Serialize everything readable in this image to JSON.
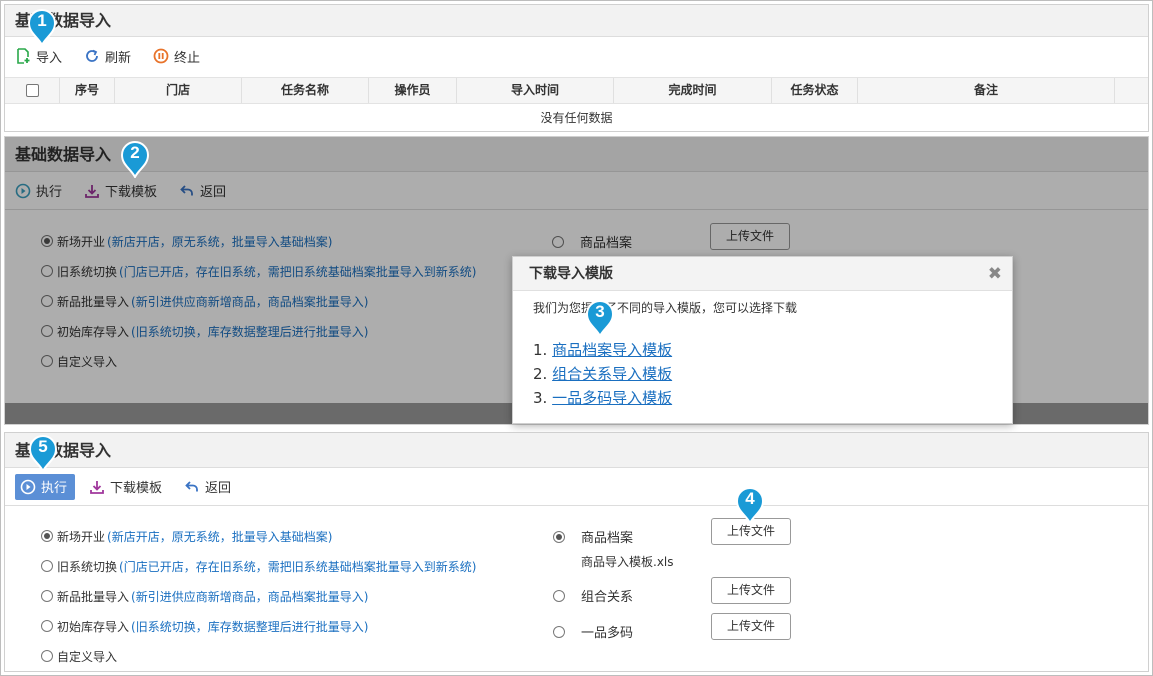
{
  "panel1": {
    "title": "基础数据导入",
    "toolbar": {
      "import": "导入",
      "refresh": "刷新",
      "stop": "终止"
    },
    "columns": [
      "序号",
      "门店",
      "任务名称",
      "操作员",
      "导入时间",
      "完成时间",
      "任务状态",
      "备注"
    ],
    "empty_text": "没有任何数据"
  },
  "panel2": {
    "title": "基础数据导入",
    "toolbar": {
      "execute": "执行",
      "download": "下载模板",
      "back": "返回"
    },
    "options": [
      {
        "label": "新场开业",
        "hint": "(新店开店，原无系统，批量导入基础档案)"
      },
      {
        "label": "旧系统切换",
        "hint": "(门店已开店，存在旧系统，需把旧系统基础档案批量导入到新系统)"
      },
      {
        "label": "新品批量导入",
        "hint": "(新引进供应商新增商品，商品档案批量导入)"
      },
      {
        "label": "初始库存导入",
        "hint": "(旧系统切换，库存数据整理后进行批量导入)"
      },
      {
        "label": "自定义导入",
        "hint": ""
      }
    ],
    "right_label": "商品档案",
    "upload": "上传文件"
  },
  "dialog": {
    "title": "下载导入模版",
    "description": "我们为您提供了不同的导入模版，您可以选择下载",
    "items": [
      {
        "num": "1.",
        "label": "商品档案导入模板"
      },
      {
        "num": "2.",
        "label": "组合关系导入模板"
      },
      {
        "num": "3.",
        "label": "一品多码导入模板"
      }
    ]
  },
  "panel3": {
    "title": "基础数据导入",
    "toolbar": {
      "execute": "执行",
      "download": "下载模板",
      "back": "返回"
    },
    "options": [
      {
        "label": "新场开业",
        "hint": "(新店开店，原无系统，批量导入基础档案)"
      },
      {
        "label": "旧系统切换",
        "hint": "(门店已开店，存在旧系统，需把旧系统基础档案批量导入到新系统)"
      },
      {
        "label": "新品批量导入",
        "hint": "(新引进供应商新增商品，商品档案批量导入)"
      },
      {
        "label": "初始库存导入",
        "hint": "(旧系统切换，库存数据整理后进行批量导入)"
      },
      {
        "label": "自定义导入",
        "hint": ""
      }
    ],
    "right_options": [
      {
        "label": "商品档案",
        "upload": "上传文件",
        "file": "商品导入模板.xls"
      },
      {
        "label": "组合关系",
        "upload": "上传文件"
      },
      {
        "label": "一品多码",
        "upload": "上传文件"
      }
    ]
  },
  "badges": [
    "1",
    "2",
    "3",
    "4",
    "5"
  ],
  "colors": {
    "badge": "#1a9ad6",
    "link": "#1a6fc0",
    "active_button": "#5b8fd6"
  }
}
